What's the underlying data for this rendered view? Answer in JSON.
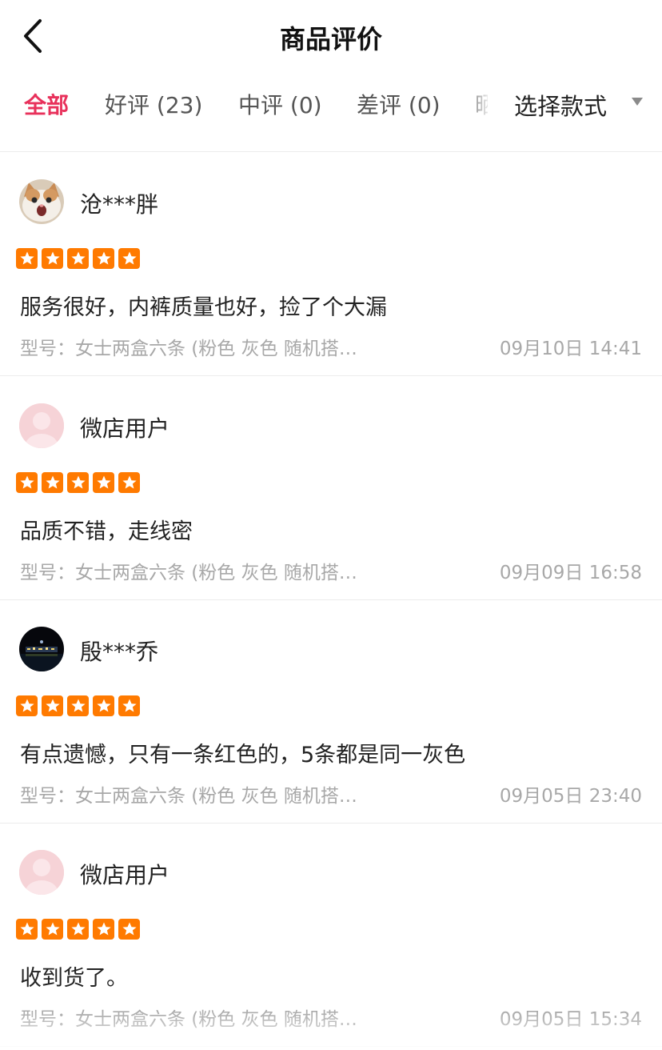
{
  "header": {
    "title": "商品评价",
    "back_icon": "chevron-left-icon"
  },
  "tabs": [
    {
      "label": "全部",
      "active": true
    },
    {
      "label": "好评 (23)",
      "active": false
    },
    {
      "label": "中评 (0)",
      "active": false
    },
    {
      "label": "差评 (0)",
      "active": false
    },
    {
      "label": "晒",
      "active": false
    }
  ],
  "style_filter": {
    "label": "选择款式",
    "icon": "caret-down-icon"
  },
  "colors": {
    "accent": "#e8315b",
    "star": "#ff7a00",
    "muted_text": "#a8a8a8",
    "divider": "#ececec",
    "default_avatar": "#f6d3d7"
  },
  "reviews": [
    {
      "user": "沧***胖",
      "avatar": "cat-avatar",
      "rating": 5,
      "text": "服务很好，内裤质量也好，捡了个大漏",
      "spec": "型号：女士两盒六条 (粉色 灰色 随机搭…",
      "time": "09月10日 14:41"
    },
    {
      "user": "微店用户",
      "avatar": "default-avatar",
      "rating": 5,
      "text": "品质不错，走线密",
      "spec": "型号：女士两盒六条 (粉色 灰色 随机搭…",
      "time": "09月09日 16:58"
    },
    {
      "user": "殷***乔",
      "avatar": "night-city-avatar",
      "rating": 5,
      "text": "有点遗憾，只有一条红色的，5条都是同一灰色",
      "spec": "型号：女士两盒六条 (粉色 灰色 随机搭…",
      "time": "09月05日 23:40"
    },
    {
      "user": "微店用户",
      "avatar": "default-avatar",
      "rating": 5,
      "text": "收到货了。",
      "spec": "型号：女士两盒六条 (粉色 灰色 随机搭…",
      "time": "09月05日 15:34"
    }
  ]
}
